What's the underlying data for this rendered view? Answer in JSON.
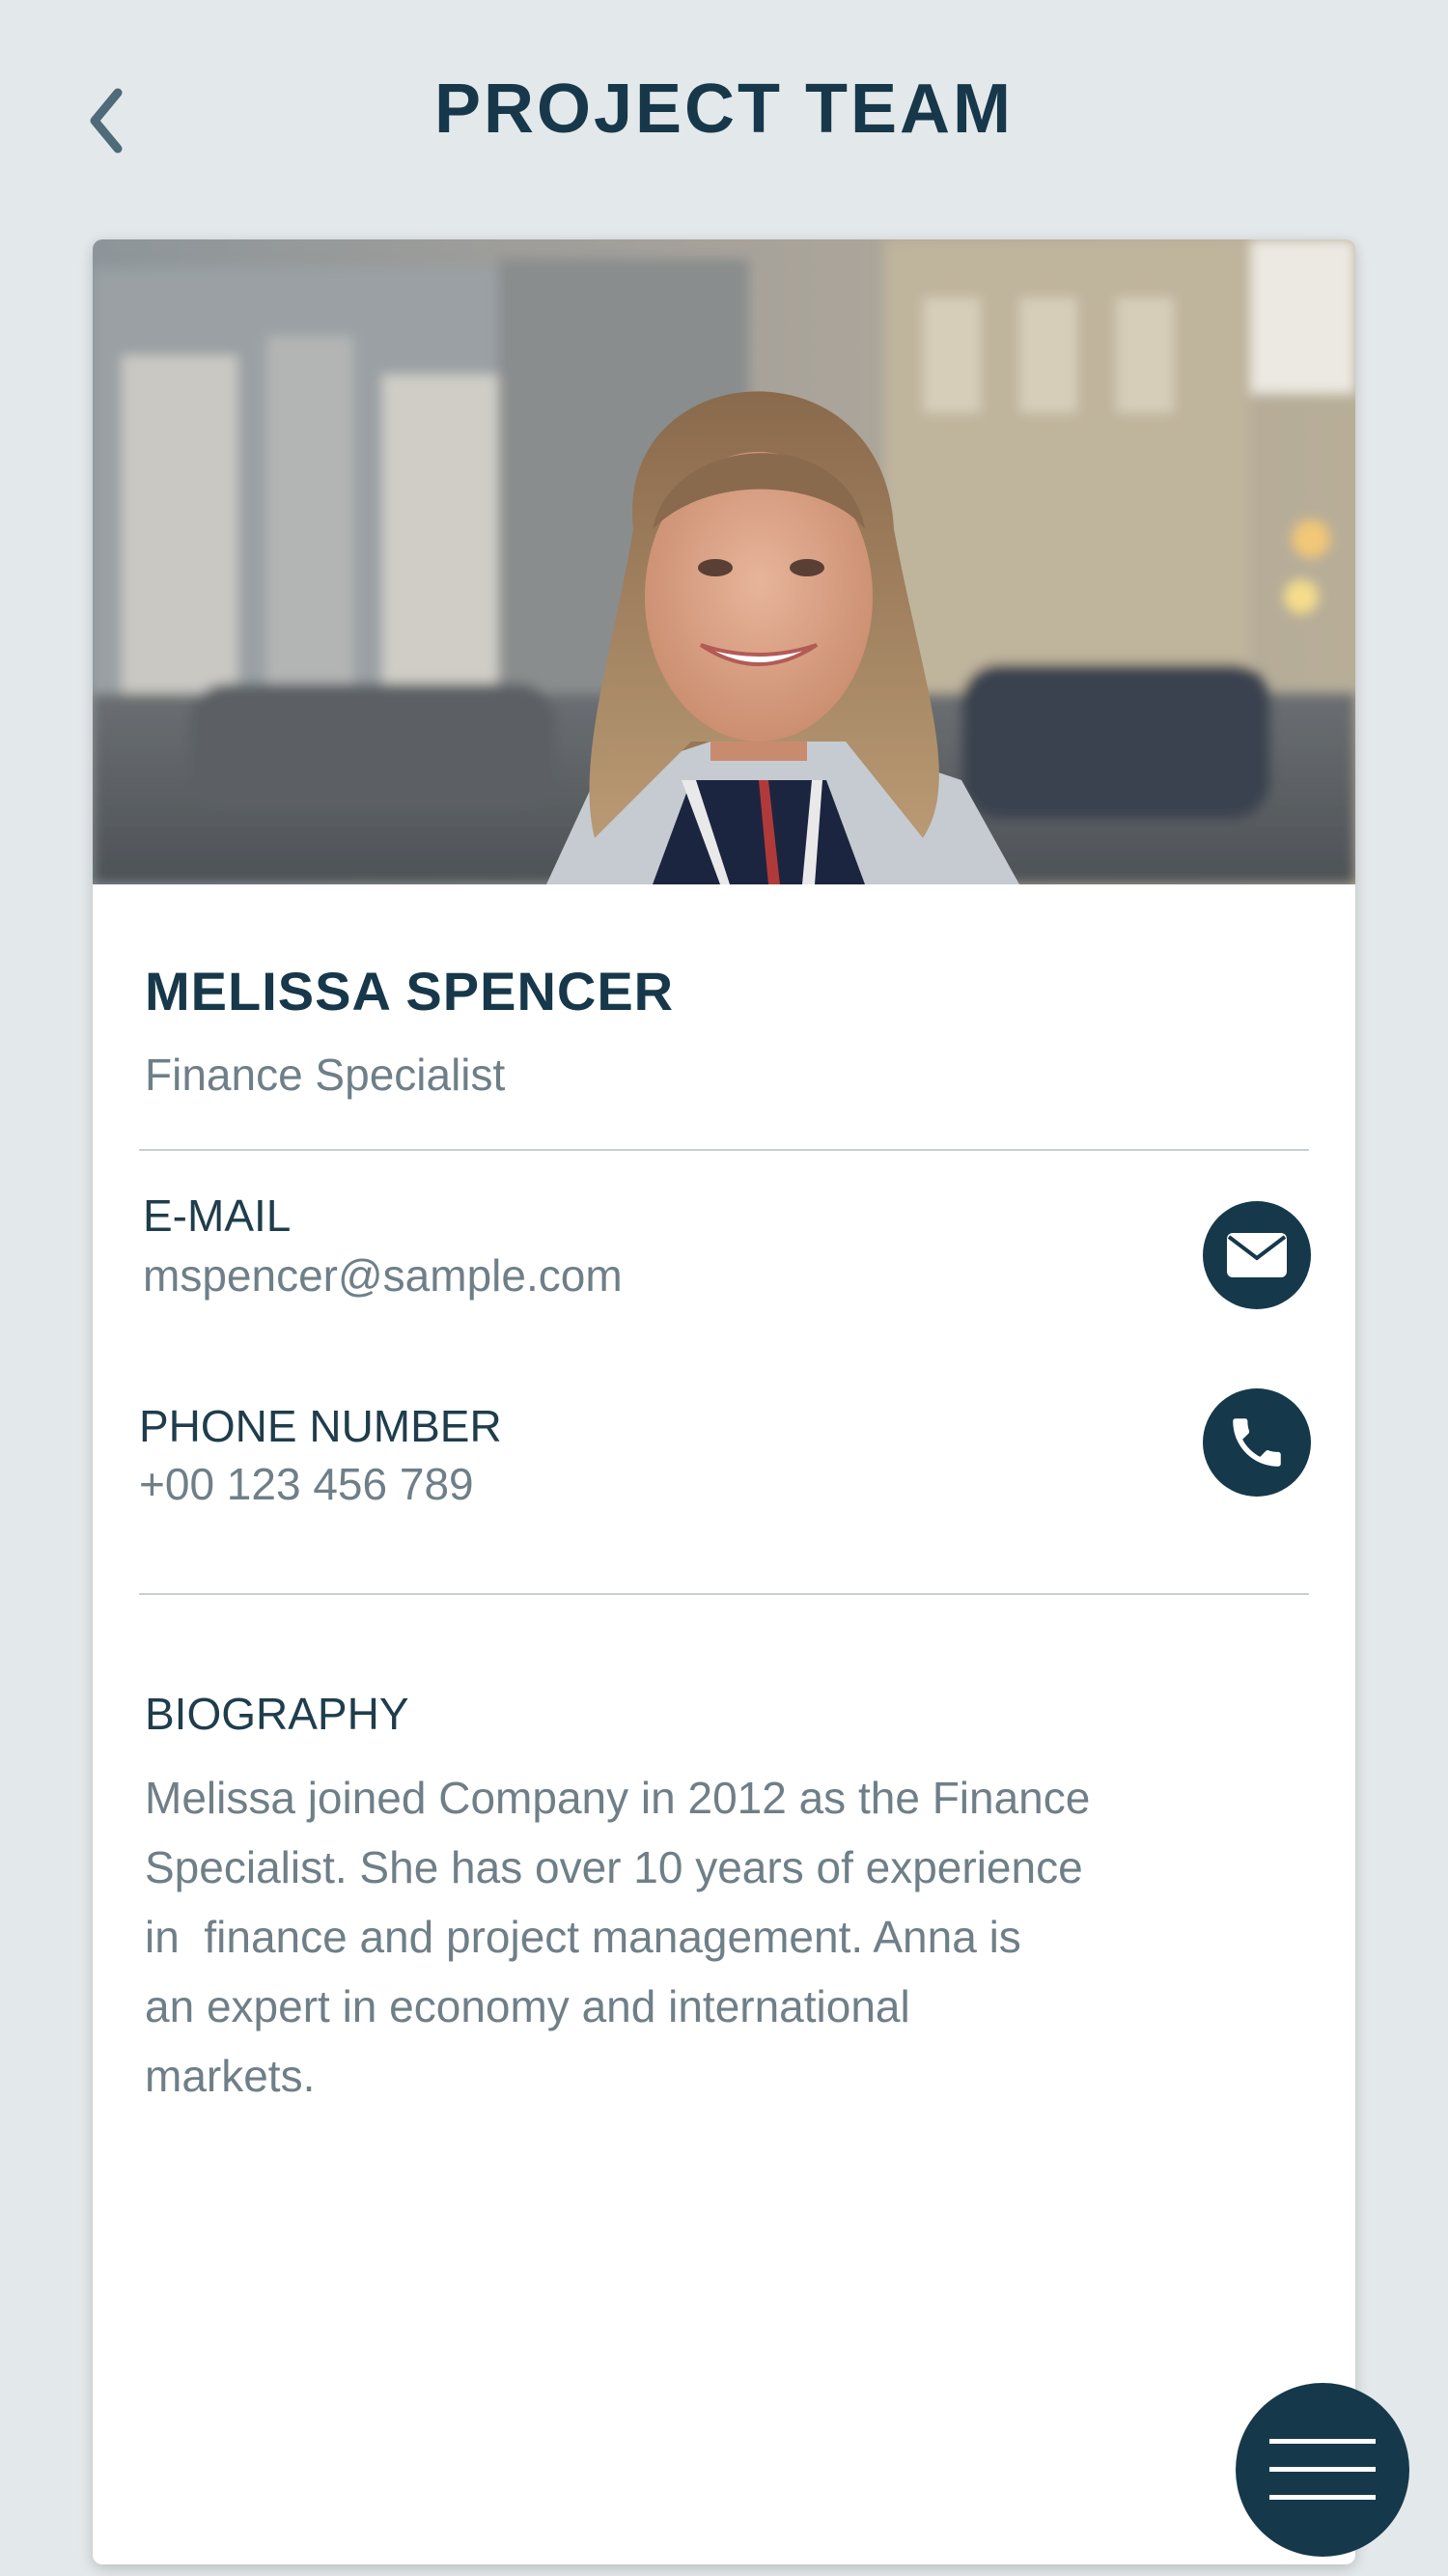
{
  "header": {
    "title": "PROJECT TEAM",
    "back_icon": "chevron-left-icon"
  },
  "profile": {
    "name": "MELISSA SPENCER",
    "role": "Finance Specialist"
  },
  "contact": {
    "email_label": "E-MAIL",
    "email_value": "mspencer@sample.com",
    "email_icon": "envelope-icon",
    "phone_label": "PHONE NUMBER",
    "phone_value": "+00 123 456 789",
    "phone_icon": "phone-icon"
  },
  "biography": {
    "label": "BIOGRAPHY",
    "text": "Melissa joined Company in 2012 as the Finance\nSpecialist. She has over 10 years of experience\nin  finance and project management. Anna is\nan expert in economy and international\nmarkets."
  },
  "menu": {
    "icon": "hamburger-menu-icon"
  },
  "colors": {
    "background": "#e3e8ea",
    "primary": "#15394a",
    "title": "#17384a",
    "muted_text": "#6f7f88",
    "card": "#ffffff"
  }
}
